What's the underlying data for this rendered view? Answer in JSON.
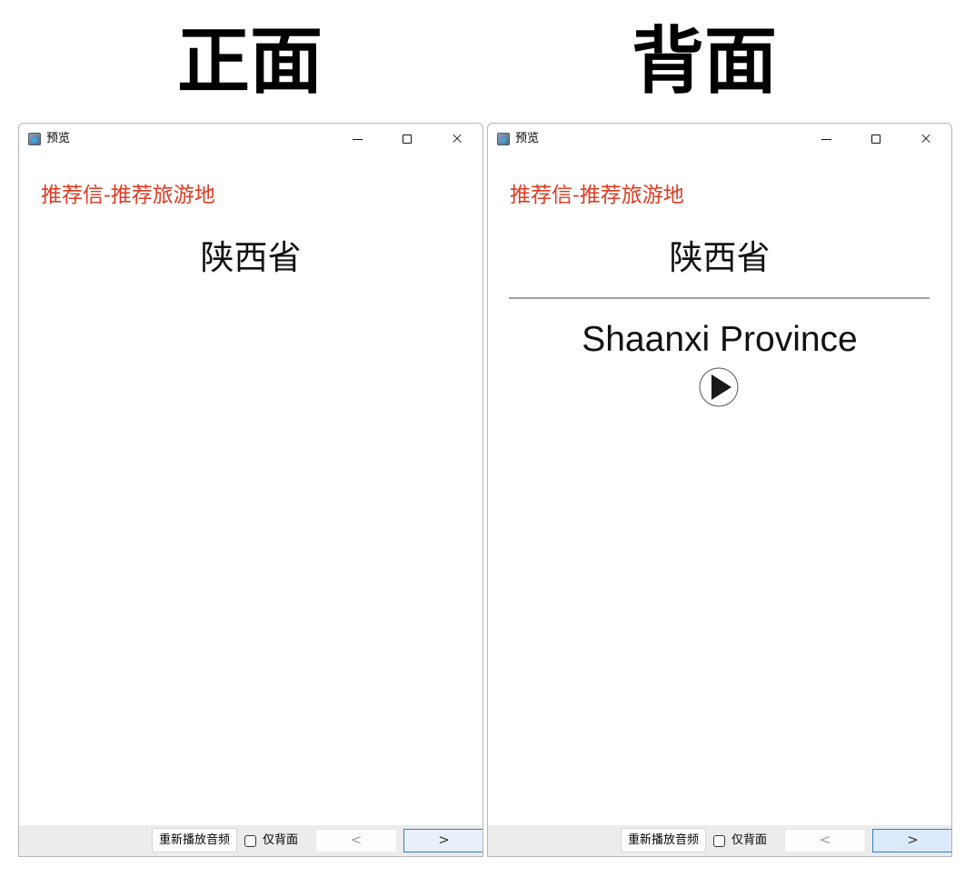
{
  "headings": {
    "front": "正面",
    "back": "背面"
  },
  "windows": {
    "front": {
      "title": "预览",
      "card_title": "推荐信-推荐旅游地",
      "front_word": "陕西省",
      "buttons": {
        "replay": "重新播放音频",
        "back_only": "仅背面",
        "prev": "<",
        "next": ">"
      },
      "back_only_checked": false
    },
    "back": {
      "title": "预览",
      "card_title": "推荐信-推荐旅游地",
      "front_word": "陕西省",
      "back_word": "Shaanxi Province",
      "buttons": {
        "replay": "重新播放音频",
        "back_only": "仅背面",
        "prev": "<",
        "next": ">"
      },
      "back_only_checked": false
    }
  },
  "icons": {
    "app": "app-icon",
    "minimize": "minimize-icon",
    "maximize": "maximize-icon",
    "close": "close-icon",
    "play": "play-icon",
    "close_glyph": "×"
  },
  "colors": {
    "card_title": "#e03a22",
    "next_button_border": "#2d7fd8"
  }
}
